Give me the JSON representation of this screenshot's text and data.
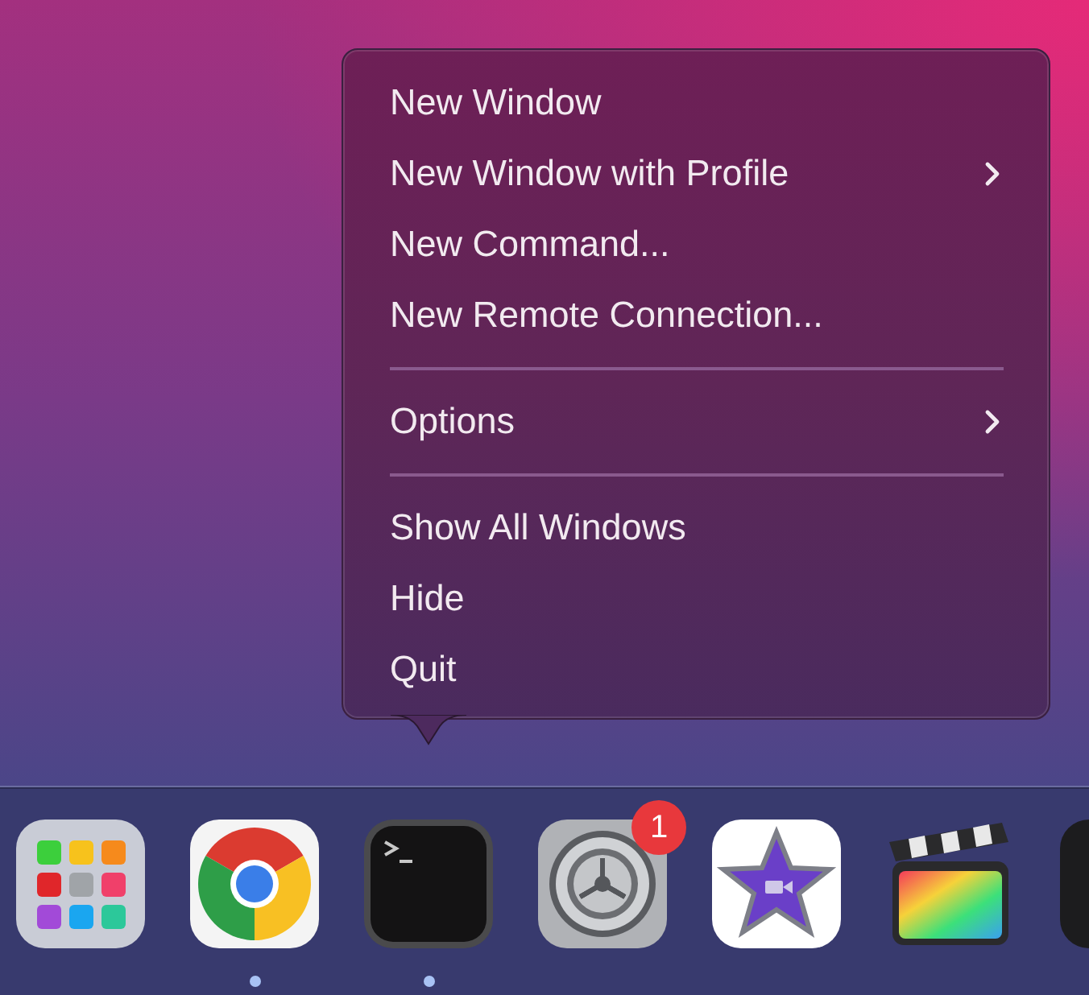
{
  "menu": {
    "items": [
      {
        "kind": "item",
        "label": "New Window",
        "submenu": false
      },
      {
        "kind": "item",
        "label": "New Window with Profile",
        "submenu": true
      },
      {
        "kind": "item",
        "label": "New Command...",
        "submenu": false
      },
      {
        "kind": "item",
        "label": "New Remote Connection...",
        "submenu": false
      },
      {
        "kind": "separator"
      },
      {
        "kind": "item",
        "label": "Options",
        "submenu": true
      },
      {
        "kind": "separator"
      },
      {
        "kind": "item",
        "label": "Show All Windows",
        "submenu": false
      },
      {
        "kind": "item",
        "label": "Hide",
        "submenu": false
      },
      {
        "kind": "item",
        "label": "Quit",
        "submenu": false
      }
    ]
  },
  "dock": {
    "apps": [
      {
        "kind": "launchpad",
        "running": false
      },
      {
        "kind": "chrome",
        "running": true
      },
      {
        "kind": "terminal",
        "running": true
      },
      {
        "kind": "settings",
        "running": false,
        "badge": "1"
      },
      {
        "kind": "imovie",
        "running": false
      },
      {
        "kind": "finalcut",
        "running": false
      },
      {
        "kind": "dark",
        "running": false
      }
    ]
  }
}
